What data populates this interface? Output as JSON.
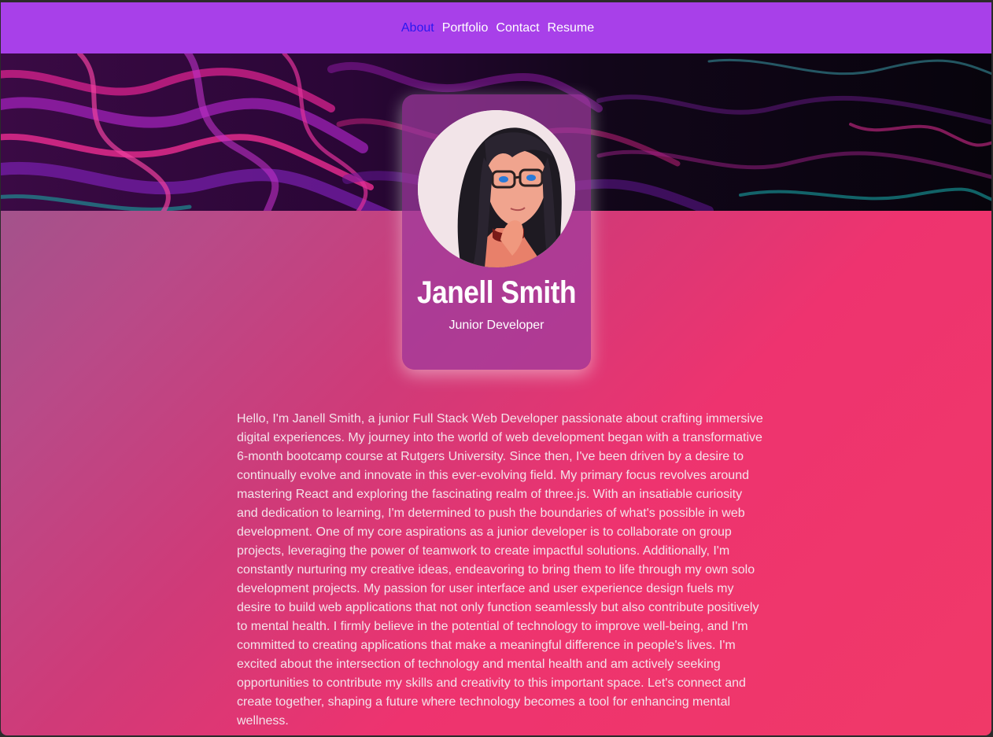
{
  "nav": {
    "items": [
      {
        "label": "About",
        "active": true
      },
      {
        "label": "Portfolio",
        "active": false
      },
      {
        "label": "Contact",
        "active": false
      },
      {
        "label": "Resume",
        "active": false
      }
    ],
    "background": "#a840e9",
    "active_color": "#2b18f0"
  },
  "hero": {
    "image": "abstract-purple-swirl-banner"
  },
  "profile": {
    "name": "Janell Smith",
    "role": "Junior Developer",
    "avatar": "illustrated-portrait-with-glasses"
  },
  "bio": {
    "text": "Hello, I'm Janell Smith, a junior Full Stack Web Developer passionate about crafting immersive digital experiences. My journey into the world of web development began with a transformative 6-month bootcamp course at Rutgers University. Since then, I've been driven by a desire to continually evolve and innovate in this ever-evolving field. My primary focus revolves around mastering React and exploring the fascinating realm of three.js. With an insatiable curiosity and dedication to learning, I'm determined to push the boundaries of what's possible in web development. One of my core aspirations as a junior developer is to collaborate on group projects, leveraging the power of teamwork to create impactful solutions. Additionally, I'm constantly nurturing my creative ideas, endeavoring to bring them to life through my own solo development projects. My passion for user interface and user experience design fuels my desire to build web applications that not only function seamlessly but also contribute positively to mental health. I firmly believe in the potential of technology to improve well-being, and I'm committed to creating applications that make a meaningful difference in people's lives. I'm excited about the intersection of technology and mental health and am actively seeking opportunities to contribute my skills and creativity to this important space. Let's connect and create together, shaping a future where technology becomes a tool for enhancing mental wellness."
  },
  "colors": {
    "page_gradient_start": "#8f5a8f",
    "page_gradient_end": "#f03968",
    "card_background": "#a03ca0"
  }
}
